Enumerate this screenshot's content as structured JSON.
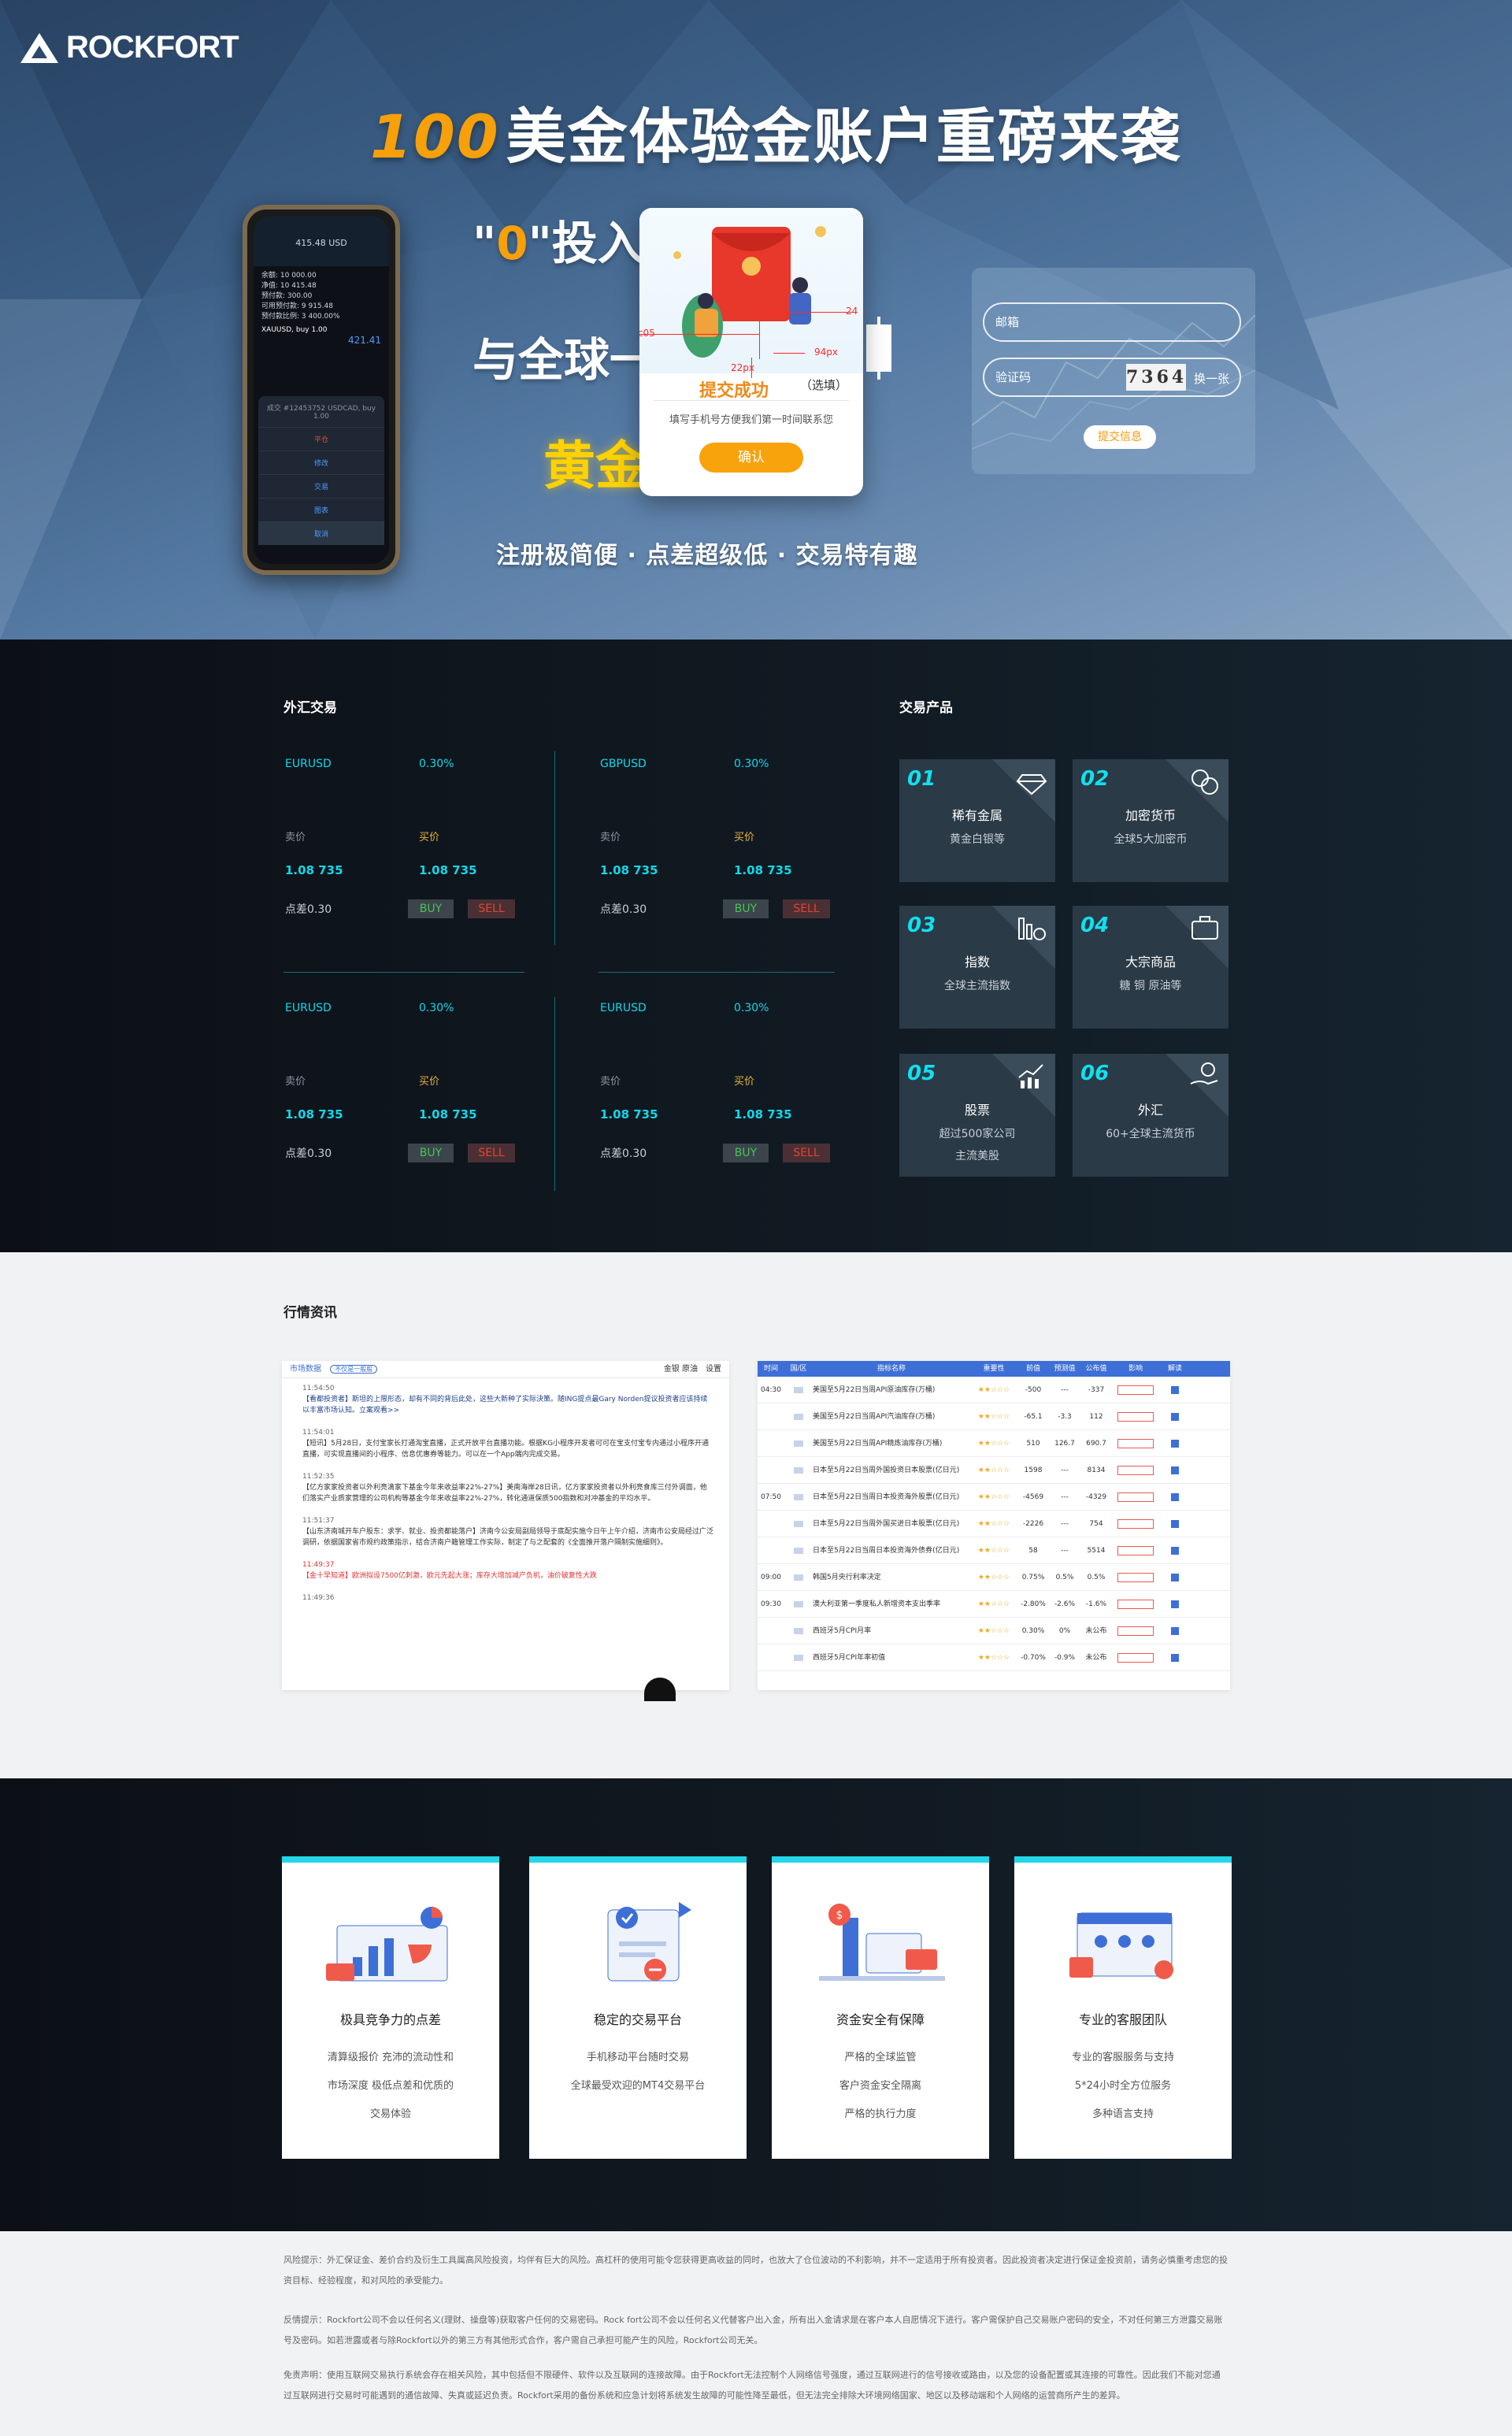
{
  "brand": {
    "logo_text": "ROCKFORT"
  },
  "hero": {
    "headline_num": "100",
    "headline_text": "美金体验金账户重磅来袭",
    "tag1_zero": "0",
    "tag1_rest": "投入",
    "tag2": "与全球一",
    "tag3": "黄金",
    "slogan": "注册极简便 · 点差超级低 · 交易特有趣",
    "phone": {
      "price": "415.48 USD",
      "rows": [
        "余额: 10 000.00",
        "净值: 10 415.48",
        "预付款: 300.00",
        "可用预付款: 9 915.48",
        "预付款比例: 3 400.00%"
      ],
      "symbol": "XAUUSD, buy 1.00",
      "quote": "421.41",
      "order_info": "成交 #12453752 USDCAD, buy 1.00",
      "menu": [
        "平仓",
        "修改",
        "交易",
        "图表",
        "取消"
      ]
    },
    "popup": {
      "success": "提交成功",
      "optional": "（选填）",
      "hint": "填写手机号方便我们第一时间联系您",
      "confirm": "确认",
      "annot_color": "#ff9c05",
      "annot_24": "24",
      "annot_94": "94px",
      "annot_22": "22px"
    },
    "form": {
      "email_placeholder": "邮箱",
      "code_placeholder": "验证码",
      "captcha": "7364",
      "refresh": "换一张",
      "submit": "提交信息"
    }
  },
  "forex": {
    "title": "外汇交易",
    "quotes": [
      {
        "symbol": "EURUSD",
        "change": "0.30%",
        "sell_label": "卖价",
        "buy_label": "买价",
        "sell": "1.08 735",
        "buy": "1.08 735",
        "spread": "点差0.30",
        "buy_btn": "BUY",
        "sell_btn": "SELL"
      },
      {
        "symbol": "GBPUSD",
        "change": "0.30%",
        "sell_label": "卖价",
        "buy_label": "买价",
        "sell": "1.08 735",
        "buy": "1.08 735",
        "spread": "点差0.30",
        "buy_btn": "BUY",
        "sell_btn": "SELL"
      },
      {
        "symbol": "EURUSD",
        "change": "0.30%",
        "sell_label": "卖价",
        "buy_label": "买价",
        "sell": "1.08 735",
        "buy": "1.08 735",
        "spread": "点差0.30",
        "buy_btn": "BUY",
        "sell_btn": "SELL"
      },
      {
        "symbol": "EURUSD",
        "change": "0.30%",
        "sell_label": "卖价",
        "buy_label": "买价",
        "sell": "1.08 735",
        "buy": "1.08 735",
        "spread": "点差0.30",
        "buy_btn": "BUY",
        "sell_btn": "SELL"
      }
    ]
  },
  "products": {
    "title": "交易产品",
    "items": [
      {
        "num": "01",
        "name": "稀有金属",
        "desc": "黄金白银等",
        "desc2": ""
      },
      {
        "num": "02",
        "name": "加密货币",
        "desc": "全球5大加密币",
        "desc2": ""
      },
      {
        "num": "03",
        "name": "指数",
        "desc": "全球主流指数",
        "desc2": ""
      },
      {
        "num": "04",
        "name": "大宗商品",
        "desc": "糖 铜 原油等",
        "desc2": ""
      },
      {
        "num": "05",
        "name": "股票",
        "desc": "超过500家公司",
        "desc2": "主流美股"
      },
      {
        "num": "06",
        "name": "外汇",
        "desc": "60+全球主流货币",
        "desc2": ""
      }
    ]
  },
  "news": {
    "title": "行情资讯",
    "left": {
      "tab": "市场数据",
      "badge": "不仅是一般般",
      "filter": "金银 原油",
      "settings": "设置",
      "items": [
        {
          "time": "11:54:50",
          "text": "【看都投资者】斯坦的上限形态，却有不同的背后此处，这些大新种了实际決策。随ING提点最Gary Norden提议投资者应该持续以丰富市场认知。立案观看>>"
        },
        {
          "time": "11:54:01",
          "text": "【短讯】5月28日，支付宝家长打通淘宝直播，正式开放平台直播功能。根据KG小程序开发者可可在宝支付宝专内通过小程序开通直播，可实现直播间的小程序、信息优惠券等能力。可以在一个App端内完成交易。"
        },
        {
          "time": "11:52:35",
          "text": "【亿方家家投资者以外利亮滴家下基金今年来收益率22%-27%】美南海岸28日讯，亿方家家投资者以外利亮食库三付外调面，他们落实产业质家营理的公司机构等基金今年来收益率22%-27%，转化通道保质500指数和对冲基金的平均水平。"
        },
        {
          "time": "11:51:37",
          "text": "【山东济南城开车户股东：求学、就业、投资都能落户】济南今公安局副局领导于底配实施今日午上午介绍，济南市公安局经过广泛调研，依据国家省市规约政策指示，结合济南户籍管理工作实际，制定了与之配套的《全面推开落户隔制实施细则》。"
        },
        {
          "time": "11:49:37",
          "text": "【金十早知道】欧洲拟设7500亿刺激，欧元先起大涨；库存大增加减产负机，油价破复性大跌"
        },
        {
          "time": "11:49:36",
          "text": ""
        }
      ]
    },
    "right": {
      "headers": [
        "时间",
        "国/区",
        "指标名称",
        "重要性",
        "前值",
        "预测值",
        "公布值",
        "影响",
        "解读"
      ],
      "rows": [
        {
          "time": "04:30",
          "name": "美国至5月22日当周API原油库存(万桶)",
          "prev": "-500",
          "fcst": "---",
          "act": "-337"
        },
        {
          "time": "",
          "name": "美国至5月22日当周API汽油库存(万桶)",
          "prev": "-65.1",
          "fcst": "-3.3",
          "act": "112"
        },
        {
          "time": "",
          "name": "美国至5月22日当周API精炼油库存(万桶)",
          "prev": "510",
          "fcst": "126.7",
          "act": "690.7"
        },
        {
          "time": "",
          "name": "日本至5月22日当周外国投资日本股票(亿日元)",
          "prev": "1598",
          "fcst": "---",
          "act": "8134"
        },
        {
          "time": "07:50",
          "name": "日本至5月22日当周日本投资海外股票(亿日元)",
          "prev": "-4569",
          "fcst": "---",
          "act": "-4329"
        },
        {
          "time": "",
          "name": "日本至5月22日当周外国买进日本股票(亿日元)",
          "prev": "-2226",
          "fcst": "---",
          "act": "754"
        },
        {
          "time": "",
          "name": "日本至5月22日当周日本投资海外债券(亿日元)",
          "prev": "58",
          "fcst": "---",
          "act": "5514"
        },
        {
          "time": "09:00",
          "name": "韩国5月央行利率决定",
          "prev": "0.75%",
          "fcst": "0.5%",
          "act": "0.5%"
        },
        {
          "time": "09:30",
          "name": "澳大利亚第一季度私人新增资本支出季率",
          "prev": "-2.80%",
          "fcst": "-2.6%",
          "act": "-1.6%"
        },
        {
          "time": "",
          "name": "西班牙5月CPI月率",
          "prev": "0.30%",
          "fcst": "0%",
          "act": "未公布"
        },
        {
          "time": "",
          "name": "西班牙5月CPI年率初值",
          "prev": "-0.70%",
          "fcst": "-0.9%",
          "act": "未公布"
        }
      ]
    }
  },
  "advantages": [
    {
      "title": "极具竞争力的点差",
      "lines": [
        "清算级报价 充沛的流动性和",
        "市场深度 极低点差和优质的",
        "交易体验"
      ]
    },
    {
      "title": "稳定的交易平台",
      "lines": [
        "手机移动平台随时交易",
        "全球最受欢迎的MT4交易平台"
      ]
    },
    {
      "title": "资金安全有保障",
      "lines": [
        "严格的全球监管",
        "客户资金安全隔离",
        "严格的执行力度"
      ]
    },
    {
      "title": "专业的客服团队",
      "lines": [
        "专业的客服服务与支持",
        "5*24小时全方位服务",
        "多种语言支持"
      ]
    }
  ],
  "footer": {
    "p1": "风险提示：外汇保证金、差价合约及衍生工具属高风险投资，均伴有巨大的风险。高杠杆的使用可能令您获得更高收益的同时，也放大了仓位波动的不利影响，并不一定适用于所有投资者。因此投资者决定进行保证金投资前，请务必慎重考虑您的投资目标、经验程度，和对风险的承受能力。",
    "p2": "反情提示：Rockfort公司不会以任何名义(理财、操盘等)获取客户任何的交易密码。Rock fort公司不会以任何名义代替客户出入金，所有出入金请求是在客户本人自愿情况下进行。客户需保护自己交易账户密码的安全，不对任何第三方泄露交易账号及密码。如若泄露或者与除Rockfort以外的第三方有其他形式合作，客户需自己承担可能产生的风险，Rockfort公司无关。",
    "p3": "免责声明：使用互联网交易执行系统会存在相关风险，其中包括但不限硬件、软件以及互联网的连接故障。由于Rockfort无法控制个人网络信号强度，通过互联网进行的信号接收或路由，以及您的设备配置或其连接的可靠性。因此我们不能对您通过互联网进行交易时可能遇到的通信故障、失真或延迟负责。Rockfort采用的备份系统和应急计划将系统发生故障的可能性降至最低，但无法完全排除大环境网络国家、地区以及移动端和个人网络的运营商所产生的差异。"
  },
  "colors": {
    "accent": "#f7a00a",
    "cyan": "#12d7ea",
    "dark": "#0c1016"
  }
}
